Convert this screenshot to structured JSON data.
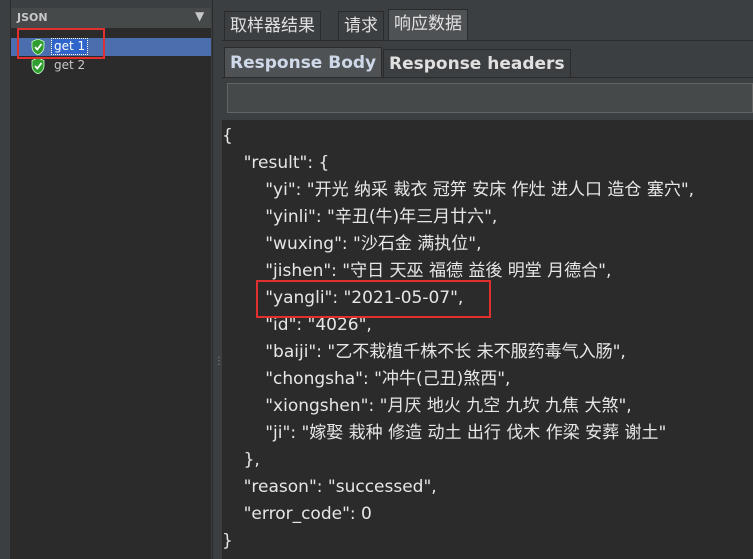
{
  "tree": {
    "title": "JSON",
    "arrow": "▼",
    "items": [
      {
        "label": "get 1",
        "selected": true
      },
      {
        "label": "get 2",
        "selected": false
      }
    ]
  },
  "tabs": [
    {
      "label": "取样器结果",
      "selected": false
    },
    {
      "label": "请求",
      "selected": false
    },
    {
      "label": "响应数据",
      "selected": true
    }
  ],
  "subtabs": [
    {
      "label": "Response Body",
      "selected": true
    },
    {
      "label": "Response headers",
      "selected": false
    }
  ],
  "search": {
    "value": ""
  },
  "response_lines": [
    "{",
    "    \"result\": {",
    "        \"yi\": \"开光 纳采 裁衣 冠笄 安床 作灶 进人口 造仓 塞穴\",",
    "        \"yinli\": \"辛丑(牛)年三月廿六\",",
    "        \"wuxing\": \"沙石金 满执位\",",
    "        \"jishen\": \"守日 天巫 福德 益後 明堂 月德合\",",
    "        \"yangli\": \"2021-05-07\",",
    "        \"id\": \"4026\",",
    "        \"baiji\": \"乙不栽植千株不长 未不服药毒气入肠\",",
    "        \"chongsha\": \"冲牛(己丑)煞西\",",
    "        \"xiongshen\": \"月厌 地火 九空 九坎 九焦 大煞\",",
    "        \"ji\": \"嫁娶 栽种 修造 动土 出行 伐木 作梁 安葬 谢土\"",
    "    },",
    "    \"reason\": \"successed\",",
    "    \"error_code\": 0",
    "}"
  ],
  "colors": {
    "panel": "#3c3f41",
    "editor": "#2b2b2b",
    "selection": "#4b6eaf",
    "shield_green": "#3fbf3f",
    "highlight_box": "#e03030"
  }
}
